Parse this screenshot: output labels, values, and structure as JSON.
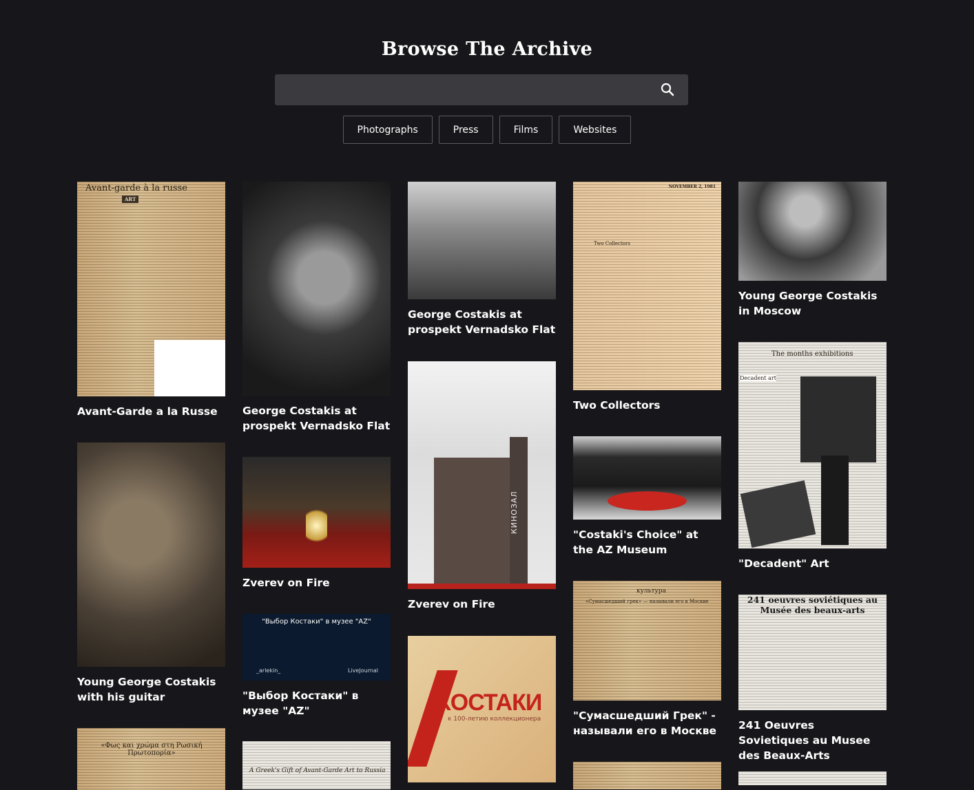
{
  "header": {
    "title": "Browse The Archive"
  },
  "search": {
    "placeholder": "",
    "value": "",
    "icon": "search-icon"
  },
  "filters": [
    "Photographs",
    "Press",
    "Films",
    "Websites"
  ],
  "colors": {
    "background": "#17161a",
    "search_bg": "#3b3a3e",
    "text": "#ffffff",
    "filter_border": "#5b5a5e"
  },
  "grid": {
    "columns": [
      {
        "items": [
          {
            "caption": "Avant-Garde a la Russe",
            "headline": "Avant-garde à la russe",
            "subhead": "ART"
          },
          {
            "caption": "Young George Costakis with his guitar"
          },
          {
            "caption": "",
            "headline": "«Φως και χρώμα στη Ρωσική Πρωτοπορία»"
          }
        ]
      },
      {
        "items": [
          {
            "caption": "George Costakis at prospekt Vernadsko Flat"
          },
          {
            "caption": "Zverev on Fire"
          },
          {
            "caption": "\"Выбор Костаки\" в музее \"AZ\"",
            "banner_text": "\"Выбор Костаки\" в музее \"AZ\"",
            "banner_user": "_arlekin_",
            "banner_site": "LiveJournal"
          },
          {
            "caption": "",
            "headline": "A Greek's Gift of Avant-Garde Art to Russia"
          }
        ]
      },
      {
        "items": [
          {
            "caption": "George Costakis at prospekt Vernadsko Flat"
          },
          {
            "caption": "Zverev on Fire",
            "sign_text": "КИНОЗАЛ"
          },
          {
            "caption": "",
            "sign_text": "КОСТАКИ",
            "sub_text": "к 100-летию коллекционера"
          }
        ]
      },
      {
        "items": [
          {
            "caption": "Two Collectors",
            "headline": "Two Collectors",
            "date": "NOVEMBER 2, 1981"
          },
          {
            "caption": "\"Costaki's Choice\" at the AZ Museum"
          },
          {
            "caption": "\"Сумасшедший Грек\" - называли его в Москве",
            "headline": "культура",
            "subhead": "«Сумасшедший грек» — называли его в Москве"
          },
          {
            "caption": ""
          }
        ]
      },
      {
        "items": [
          {
            "caption": "Young George Costakis in Moscow"
          },
          {
            "caption": "\"Decadent\" Art",
            "headline": "The months exhibitions",
            "subhead": "Decadent art"
          },
          {
            "caption": "241 Oeuvres Sovietiques au Musee des Beaux-Arts",
            "headline": "241 oeuvres soviétiques au Musée des beaux-arts"
          },
          {
            "caption": ""
          }
        ]
      }
    ]
  }
}
